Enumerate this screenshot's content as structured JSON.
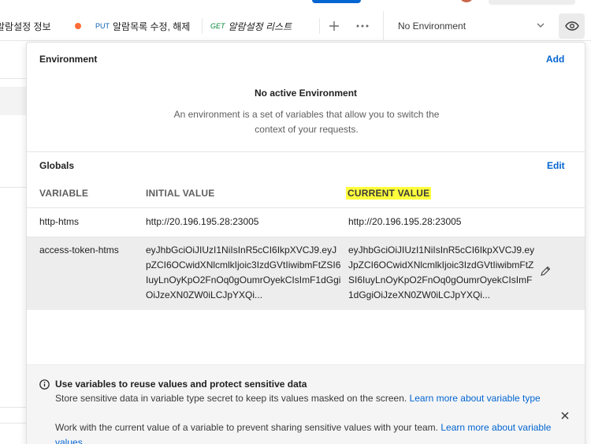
{
  "tabs": [
    {
      "label": "알람설정 정보",
      "method": "",
      "modified": true
    },
    {
      "label": "알람목록 수정, 해제",
      "method": "PUT"
    },
    {
      "label": "알람설정 리스트",
      "method": "GET"
    }
  ],
  "tabbar_actions": {
    "add_icon": "plus-icon",
    "more_icon": "ellipsis-icon"
  },
  "environment_selector": {
    "value": "No Environment",
    "icon": "chevron-down-icon"
  },
  "quick_look_icon": "eye-icon",
  "environment": {
    "heading": "Environment",
    "add_label": "Add",
    "empty_title": "No active Environment",
    "empty_description": "An environment is a set of variables that allow you to switch the context of your requests."
  },
  "globals": {
    "heading": "Globals",
    "edit_label": "Edit",
    "columns": [
      "VARIABLE",
      "INITIAL VALUE",
      "CURRENT VALUE"
    ],
    "highlighted_column": "CURRENT VALUE",
    "highlight_color": "#ffff3c",
    "rows": [
      {
        "variable": "http-htms",
        "initial": "http://20.196.195.28:23005",
        "current": "http://20.196.195.28:23005"
      },
      {
        "variable": "access-token-htms",
        "initial": "eyJhbGciOiJIUzI1NiIsInR5cCI6IkpXVCJ9.eyJpZCI6OCwidXNlcmlkIjoic3IzdGVtIiwibmFtZSI6IuyLnOyKpO2FnOq0gOumrOyekCIsImF1dGgiOiJzeXN0ZW0iLCJpYXQi...",
        "current": "eyJhbGciOiJIUzI1NiIsInR5cCI6IkpXVCJ9.eyJpZCI6OCwidXNlcmlkIjoic3IzdGVtIiwibmFtZSI6IuyLnOyKpO2FnOq0gOumrOyekCIsImF1dGgiOiJzeXN0ZW0iLCJpYXQi...",
        "edit_icon": "pencil-icon"
      }
    ]
  },
  "info": {
    "icon": "info-icon",
    "title": "Use variables to reuse values and protect sensitive data",
    "line1_text": "Store sensitive data in variable type secret to keep its values masked on the screen. ",
    "line1_link": "Learn more about variable type",
    "line2_text": "Work with the current value of a variable to prevent sharing sensitive values with your team. ",
    "line2_link": "Learn more about variable values",
    "close_icon": "close-icon"
  },
  "colors": {
    "accent": "#0265d2",
    "unsaved_dot": "#ff6c37",
    "put_method": "#0d62b8",
    "get_method": "#0b8a3c"
  }
}
